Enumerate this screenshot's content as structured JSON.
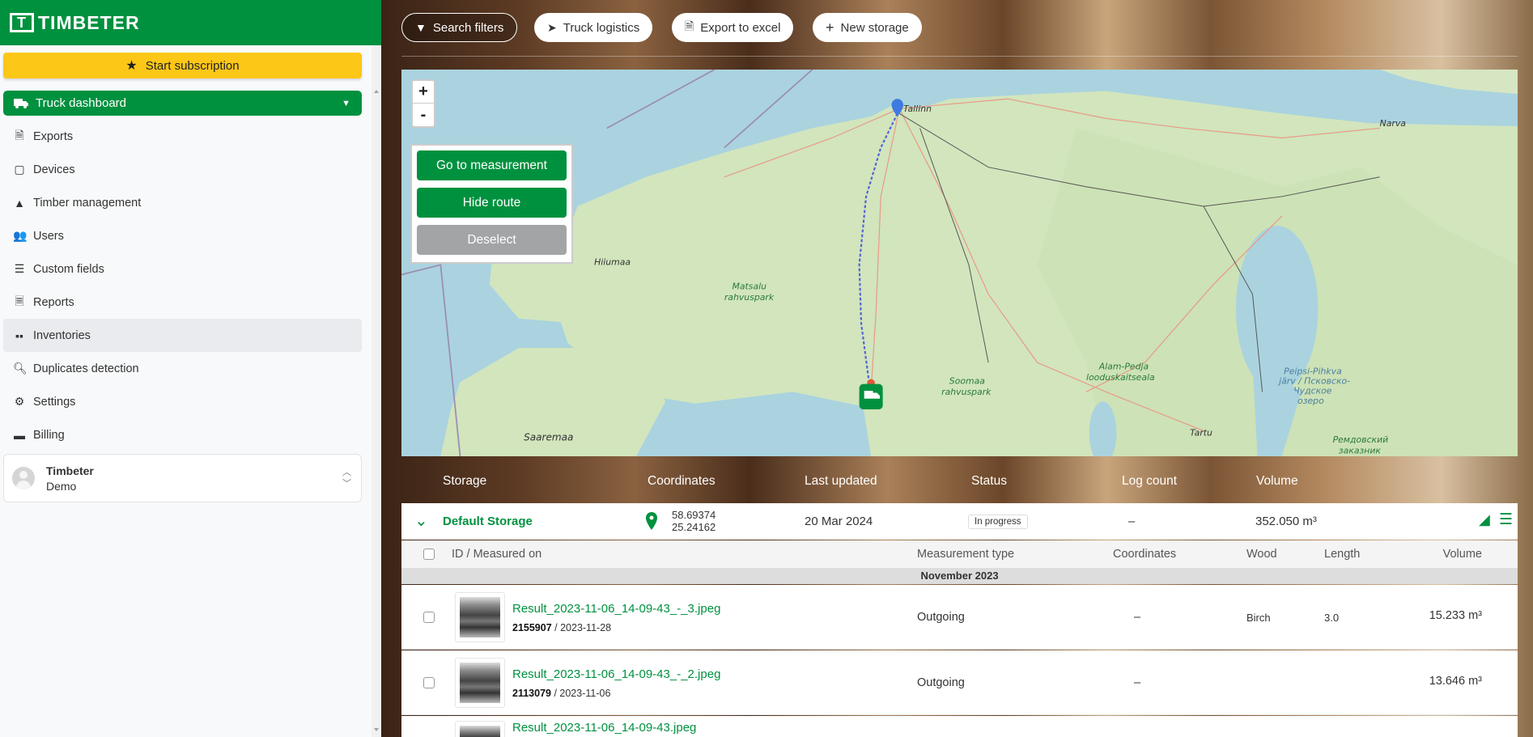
{
  "brand": {
    "name": "TIMBETER",
    "logo_letter": "T"
  },
  "sidebar": {
    "subscribe_label": "Start subscription",
    "active_item": {
      "label": "Truck dashboard",
      "icon": "truck-icon"
    },
    "items": [
      {
        "label": "Exports",
        "icon": "file-export-icon"
      },
      {
        "label": "Devices",
        "icon": "tablet-icon"
      },
      {
        "label": "Timber management",
        "icon": "tree-icon"
      },
      {
        "label": "Users",
        "icon": "users-icon"
      },
      {
        "label": "Custom fields",
        "icon": "list-icon"
      },
      {
        "label": "Reports",
        "icon": "file-icon"
      },
      {
        "label": "Inventories",
        "icon": "boxes-icon",
        "highlighted": true
      },
      {
        "label": "Duplicates detection",
        "icon": "search-icon"
      },
      {
        "label": "Settings",
        "icon": "gear-icon"
      },
      {
        "label": "Billing",
        "icon": "credit-card-icon"
      }
    ],
    "user": {
      "name": "Timbeter",
      "role": "Demo"
    }
  },
  "toolbar": {
    "search_filters": "Search filters",
    "truck_logistics": "Truck logistics",
    "export_excel": "Export to excel",
    "new_storage": "New storage"
  },
  "map": {
    "zoom_in": "+",
    "zoom_out": "-",
    "go_to_measurement": "Go to measurement",
    "hide_route": "Hide route",
    "deselect": "Deselect",
    "labels": {
      "tallinn": "Tallinn",
      "narva": "Narva",
      "hiiumaa": "Hiiumaa",
      "matsalu1": "Matsalu",
      "matsalu2": "rahvuspark",
      "saaremaa": "Saaremaa",
      "soomaa1": "Soomaa",
      "soomaa2": "rahvuspark",
      "alam1": "Alam-Pedja",
      "alam2": "looduskaitseala",
      "tartu": "Tartu",
      "peipsi1": "Peipsi-Pihkva",
      "peipsi2": "järv / Псковско-",
      "peipsi3": "Чудское",
      "peipsi4": "озеро",
      "remd1": "Ремдовский",
      "remd2": "заказник"
    }
  },
  "table": {
    "headers": [
      "Storage",
      "Coordinates",
      "Last updated",
      "Status",
      "Log count",
      "Volume"
    ],
    "storage": {
      "name": "Default Storage",
      "lat": "58.69374",
      "lon": "25.24162",
      "last_updated": "20 Mar 2024",
      "status": "In progress",
      "log_count": "–",
      "volume": "352.050 m³"
    },
    "sub_headers": {
      "id": "ID / Measured on",
      "type": "Measurement type",
      "coords": "Coordinates",
      "wood": "Wood",
      "length": "Length",
      "volume": "Volume"
    },
    "month": "November 2023",
    "rows": [
      {
        "file": "Result_2023-11-06_14-09-43_-_3.jpeg",
        "id": "2155907",
        "date": " / 2023-11-28",
        "type": "Outgoing",
        "coords": "–",
        "wood": "Birch",
        "length": "3.0",
        "volume": "15.233 m³"
      },
      {
        "file": "Result_2023-11-06_14-09-43_-_2.jpeg",
        "id": "2113079",
        "date": " / 2023-11-06",
        "type": "Outgoing",
        "coords": "–",
        "wood": "",
        "length": "",
        "volume": "13.646 m³"
      },
      {
        "file": "Result_2023-11-06_14-09-43.jpeg",
        "id": "",
        "date": "",
        "type": "",
        "coords": "",
        "wood": "",
        "length": "",
        "volume": ""
      }
    ]
  },
  "colors": {
    "brand_green": "#00913f",
    "subscribe_yellow": "#fdc718",
    "chat_orange": "#fa5a1e"
  }
}
